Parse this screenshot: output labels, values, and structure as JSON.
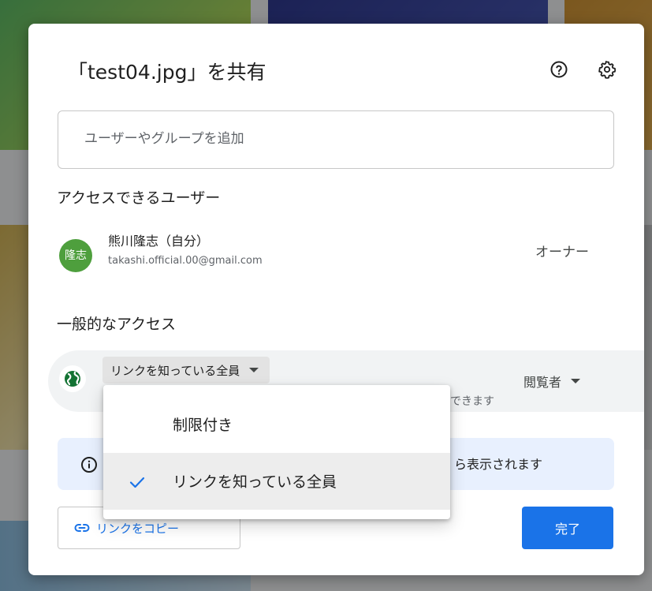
{
  "dialog": {
    "title": "「test04.jpg」を共有",
    "help_icon": "help-icon",
    "settings_icon": "gear-icon"
  },
  "add_people": {
    "placeholder": "ユーザーやグループを追加",
    "value": ""
  },
  "people_section": {
    "heading": "アクセスできるユーザー",
    "users": [
      {
        "avatar_text": "隆志",
        "name": "熊川隆志（自分）",
        "email": "takashi.official.00@gmail.com",
        "role": "オーナー",
        "avatar_color": "#4e9f3d"
      }
    ]
  },
  "general_access": {
    "heading": "一般的なアクセス",
    "selected": "リンクを知っている全員",
    "description_visible": "できます",
    "role": "閲覧者"
  },
  "access_menu": {
    "options": [
      {
        "label": "制限付き",
        "selected": false
      },
      {
        "label": "リンクを知っている全員",
        "selected": true
      }
    ]
  },
  "info_banner": {
    "text_visible": "ら表示されます"
  },
  "footer": {
    "copy_link_label": "リンクをコピー",
    "done_label": "完了"
  },
  "colors": {
    "accent": "#1a73e8",
    "banner_bg": "#e8f0fe",
    "menu_selected_bg": "#ededed"
  }
}
